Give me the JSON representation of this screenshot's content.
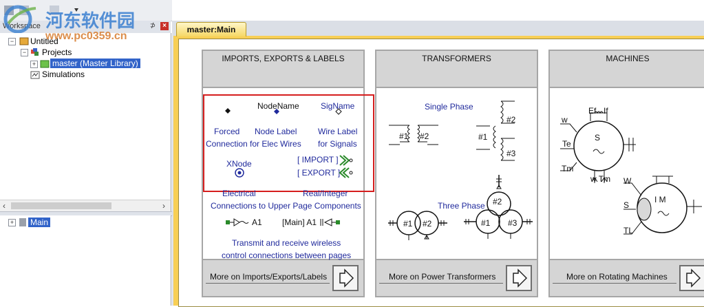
{
  "workspace": {
    "title": "Workspace",
    "pin_glyph": "⊅",
    "close_glyph": "×",
    "tree": [
      {
        "label": "Untitled",
        "icon": "workspace-icon",
        "expander": "−"
      },
      {
        "label": "Projects",
        "icon": "projects-icon",
        "expander": "−"
      },
      {
        "label": "master (Master Library)",
        "icon": "library-icon",
        "expander": "+"
      },
      {
        "label": "Simulations",
        "icon": "simulations-icon",
        "expander": ""
      }
    ],
    "bottom_tree": [
      {
        "label": "Main",
        "icon": "page-icon",
        "expander": "+"
      }
    ]
  },
  "document": {
    "tab_label": "master:Main"
  },
  "panels": {
    "imports": {
      "title": "IMPORTS, EXPORTS & LABELS",
      "node_name": "NodeName",
      "sig_name": "SigName",
      "forced": "Forced",
      "connection_for_elec_wires": "Connection for Elec Wires",
      "node_label": "Node Label",
      "wire_label": "Wire Label",
      "for_signals": "for Signals",
      "xnode": "XNode",
      "import_label": "[ IMPORT ]",
      "export_label": "[ EXPORT ]",
      "electrical": "Electrical",
      "real_integer": "Real/Integer",
      "connections_upper": "Connections to Upper Page Components",
      "a1": "A1",
      "main_a1": "[Main] A1",
      "transmit_1": "Transmit and receive wireless",
      "transmit_2": "control connections between pages",
      "more": "More on Imports/Exports/Labels"
    },
    "transformers": {
      "title": "TRANSFORMERS",
      "single_phase": "Single Phase",
      "three_phase": "Three Phase",
      "n1": "#1",
      "n2": "#2",
      "n3": "#3",
      "more": "More on Power Transformers"
    },
    "machines": {
      "title": "MACHINES",
      "ef": "Ef",
      "if": "If",
      "w": "w",
      "te": "Te",
      "tm": "Tm",
      "s": "S",
      "wtm": "w Tm",
      "w2": "W",
      "s2": "S",
      "tl": "TL",
      "im": "I M",
      "more": "More on Rotating Machines"
    }
  },
  "watermark": {
    "title": "河东软件园",
    "url": "www.pc0359.cn"
  },
  "colors": {
    "label_blue": "#202a9c",
    "highlight_red": "#d51d1d",
    "tab_gold": "#f6d866",
    "selection_blue": "#3163c9"
  }
}
